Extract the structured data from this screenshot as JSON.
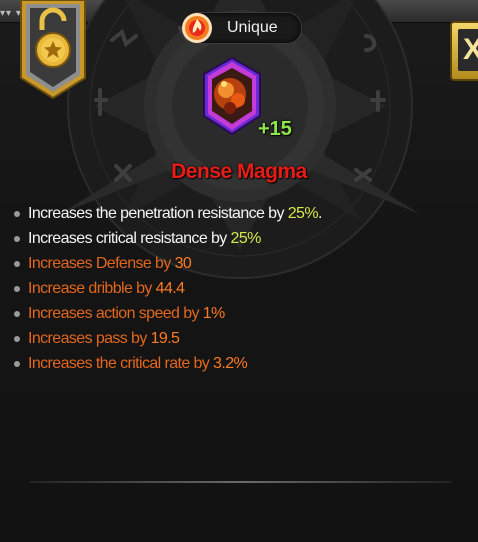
{
  "header": {
    "rarity": "Unique",
    "rarity_icon": "flame-orb-icon",
    "lock_icon": "unlocked-padlock-star-icon",
    "close_icon": "close-x-icon"
  },
  "item": {
    "name": "Dense Magma",
    "level": "+15",
    "icon": "magma-gem-icon",
    "name_color": "#e81b16"
  },
  "stats": [
    {
      "text": "Increases the penetration resistance by ",
      "value": "25%",
      "suffix": ".",
      "tier": "primary"
    },
    {
      "text": "Increases critical resistance by ",
      "value": "25%",
      "suffix": "",
      "tier": "primary"
    },
    {
      "text": "Increases Defense by ",
      "value": "30",
      "suffix": "",
      "tier": "secondary"
    },
    {
      "text": "Increase dribble by ",
      "value": "44.4",
      "suffix": "",
      "tier": "secondary"
    },
    {
      "text": "Increases action speed by ",
      "value": "1%",
      "suffix": "",
      "tier": "secondary"
    },
    {
      "text": "Increases pass by ",
      "value": "19.5",
      "suffix": "",
      "tier": "secondary"
    },
    {
      "text": "Increases the critical rate by ",
      "value": "3.2%",
      "suffix": "",
      "tier": "secondary"
    }
  ],
  "colors": {
    "primary_text": "#f4f4f4",
    "primary_value": "#d6e84a",
    "secondary_text": "#e2661d",
    "secondary_value": "#ff7a22"
  }
}
